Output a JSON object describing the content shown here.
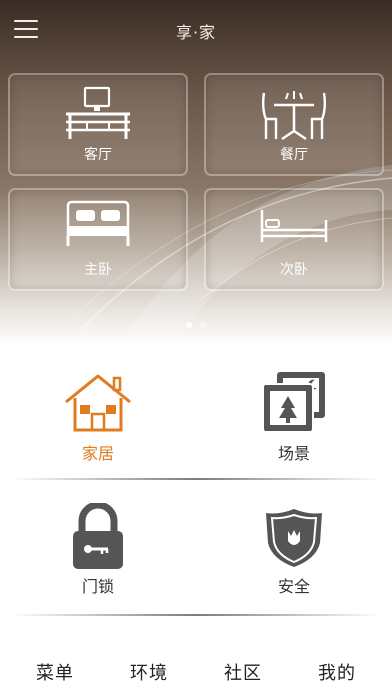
{
  "header": {
    "title": "享·家",
    "menu_icon": "hamburger-menu-icon"
  },
  "rooms": [
    {
      "label": "客厅",
      "icon": "tv-cabinet-icon"
    },
    {
      "label": "餐厅",
      "icon": "dining-table-icon"
    },
    {
      "label": "主卧",
      "icon": "double-bed-icon"
    },
    {
      "label": "次卧",
      "icon": "single-bed-icon"
    }
  ],
  "carousel": {
    "pages": 2,
    "active_index": 0
  },
  "features": {
    "home": {
      "label": "家居",
      "icon": "house-icon",
      "color": "#e07b20"
    },
    "scene": {
      "label": "场景",
      "icon": "photo-frames-icon"
    },
    "lock": {
      "label": "门锁",
      "icon": "padlock-icon"
    },
    "security": {
      "label": "安全",
      "icon": "shield-icon"
    }
  },
  "bottom_nav": [
    {
      "label": "菜单"
    },
    {
      "label": "环境"
    },
    {
      "label": "社区"
    },
    {
      "label": "我的"
    }
  ]
}
